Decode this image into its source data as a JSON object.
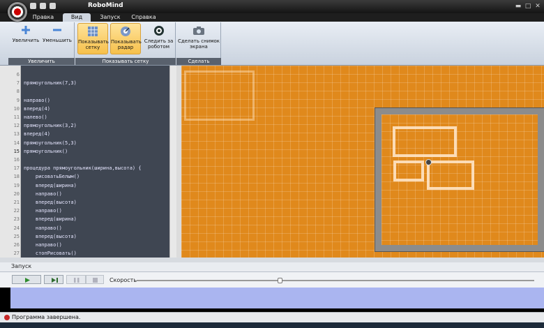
{
  "window": {
    "title": "RoboMind"
  },
  "tabs": [
    "Правка",
    "Вид",
    "Запуск",
    "Справка"
  ],
  "ribbon": {
    "zoom_in": "Увеличить",
    "zoom_out": "Уменьшить",
    "group_zoom": "Увеличить",
    "show_grid": "Показывать сетку",
    "show_radar": "Показывать радар",
    "follow_robot": "Следить за роботом",
    "group_grid": "Показывать сетку",
    "screenshot": "Сделать снимок экрана",
    "group_screenshot": "Сделать снимок..."
  },
  "editor": {
    "lines": [
      {
        "n": "6",
        "code": ""
      },
      {
        "n": "7",
        "code": "прямоугольник(7,3)"
      },
      {
        "n": "8",
        "code": ""
      },
      {
        "n": "9",
        "code": "направо()"
      },
      {
        "n": "10",
        "code": "вперед(4)"
      },
      {
        "n": "11",
        "code": "налево()"
      },
      {
        "n": "12",
        "code": "прямоугольник(3,2)"
      },
      {
        "n": "13",
        "code": "вперед(4)"
      },
      {
        "n": "14",
        "code": "прямоугольник(5,3)"
      },
      {
        "n": "15",
        "code": "прямоугольник()"
      },
      {
        "n": "16",
        "code": ""
      },
      {
        "n": "17",
        "code": "процедура прямоугольник(ширина,высота) {"
      },
      {
        "n": "18",
        "code": "    рисоватьБелым()"
      },
      {
        "n": "19",
        "code": "    вперед(ширина)"
      },
      {
        "n": "20",
        "code": "    направо()"
      },
      {
        "n": "21",
        "code": "    вперед(высота)"
      },
      {
        "n": "22",
        "code": "    направо()"
      },
      {
        "n": "23",
        "code": "    вперед(ширина)"
      },
      {
        "n": "24",
        "code": "    направо()"
      },
      {
        "n": "25",
        "code": "    вперед(высота)"
      },
      {
        "n": "26",
        "code": "    направо()"
      },
      {
        "n": "27",
        "code": "    стопРисовать()"
      }
    ],
    "current_line": "15"
  },
  "run": {
    "header": "Запуск",
    "speed_label": "Скорость",
    "speed": 0.36
  },
  "status": {
    "text": "Программа завершена."
  }
}
